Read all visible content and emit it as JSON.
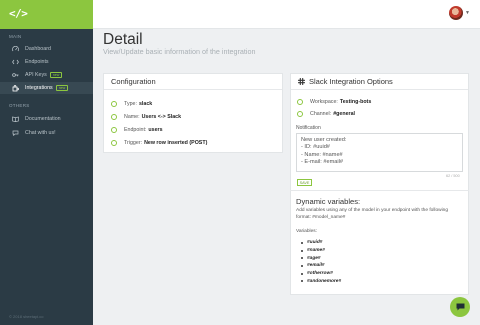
{
  "brand": {
    "logo_text": "</>"
  },
  "sidebar": {
    "sections": [
      {
        "title": "MAIN"
      },
      {
        "title": "OTHERS"
      }
    ],
    "main_items": [
      {
        "label": "Dashboard",
        "icon": "dashboard-icon"
      },
      {
        "label": "Endpoints",
        "icon": "endpoints-icon"
      },
      {
        "label": "API Keys",
        "icon": "key-icon",
        "badge": "new"
      },
      {
        "label": "Integrations",
        "icon": "puzzle-icon",
        "badge": "new",
        "active": true
      }
    ],
    "other_items": [
      {
        "label": "Documentation",
        "icon": "book-icon"
      },
      {
        "label": "Chat with us!",
        "icon": "chat-icon"
      }
    ],
    "footer": "© 2018 sheetapi.co"
  },
  "header": {
    "title": "Detail",
    "subtitle": "View/Update basic information of the integration"
  },
  "configuration": {
    "title": "Configuration",
    "rows": [
      {
        "label": "Type:",
        "value": "slack"
      },
      {
        "label": "Name:",
        "value": "Users <-> Slack"
      },
      {
        "label": "Endpoint:",
        "value": "users"
      },
      {
        "label": "Trigger:",
        "value": "New row inserted (POST)"
      }
    ]
  },
  "slack": {
    "title": "Slack Integration Options",
    "workspace": {
      "label": "Workspace:",
      "value": "Testing-bots"
    },
    "channel": {
      "label": "Channel:",
      "value": "#general"
    },
    "notification_label": "Notification",
    "notification_lines": [
      "New user created:",
      "- ID: #uuid#",
      "- Name: #name#",
      "- E-mail: #email#"
    ],
    "char_counter": "62 / 500",
    "save_label": "SAVE"
  },
  "dynamic": {
    "title": "Dynamic variables:",
    "description": "Add variables using any of the model in your endpoint with the following format: #model_name#",
    "variables_label": "Variables:",
    "variables": [
      "#uuid#",
      "#name#",
      "#age#",
      "#email#",
      "#otherrow#",
      "#andonemore#"
    ]
  },
  "colors": {
    "accent": "#8cc63f",
    "sidebar": "#2b3b45",
    "background": "#eef0f2"
  }
}
